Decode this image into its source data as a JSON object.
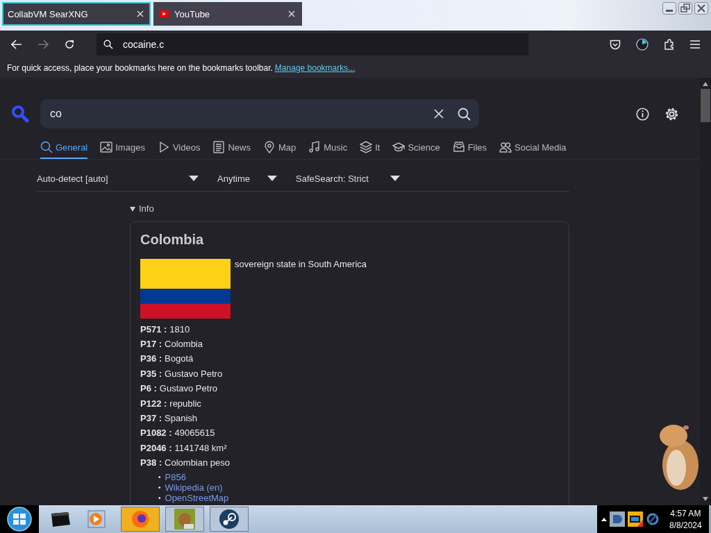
{
  "tabs": [
    {
      "label": "CollabVM SearXNG",
      "selected": true
    },
    {
      "label": "YouTube",
      "selected": false
    }
  ],
  "toolbar": {
    "url": "cocaine.c"
  },
  "bookmarks_bar": {
    "text": "For quick access, place your bookmarks here on the bookmarks toolbar.",
    "link": "Manage bookmarks..."
  },
  "search": {
    "query": "co"
  },
  "categories": [
    {
      "label": "General",
      "selected": true
    },
    {
      "label": "Images",
      "selected": false
    },
    {
      "label": "Videos",
      "selected": false
    },
    {
      "label": "News",
      "selected": false
    },
    {
      "label": "Map",
      "selected": false
    },
    {
      "label": "Music",
      "selected": false
    },
    {
      "label": "It",
      "selected": false
    },
    {
      "label": "Science",
      "selected": false
    },
    {
      "label": "Files",
      "selected": false
    },
    {
      "label": "Social Media",
      "selected": false
    }
  ],
  "filters": [
    {
      "label": "Auto-detect [auto]"
    },
    {
      "label": "Anytime"
    },
    {
      "label": "SafeSearch: Strict"
    }
  ],
  "info": {
    "label": "Info",
    "expanded": true,
    "card": {
      "title": "Colombia",
      "description": "sovereign state in South America",
      "properties": [
        {
          "key": "P571 :",
          "value": "1810"
        },
        {
          "key": "P17 :",
          "value": "Colombia"
        },
        {
          "key": "P36 :",
          "value": "Bogotá"
        },
        {
          "key": "P35 :",
          "value": "Gustavo Petro"
        },
        {
          "key": "P6 :",
          "value": "Gustavo Petro"
        },
        {
          "key": "P122 :",
          "value": "republic"
        },
        {
          "key": "P37 :",
          "value": "Spanish"
        },
        {
          "key": "P1082 :",
          "value": "49065615"
        },
        {
          "key": "P2046 :",
          "value": "1141748 km²"
        },
        {
          "key": "P38 :",
          "value": "Colombian peso"
        }
      ],
      "links": [
        {
          "bullet": "•",
          "label": "P856"
        },
        {
          "bullet": "•",
          "label": "Wikipedia (en)"
        },
        {
          "bullet": "•",
          "label": "OpenStreetMap"
        }
      ]
    }
  },
  "taskbar": {
    "time": "4:57 AM",
    "date": "8/8/2024"
  }
}
